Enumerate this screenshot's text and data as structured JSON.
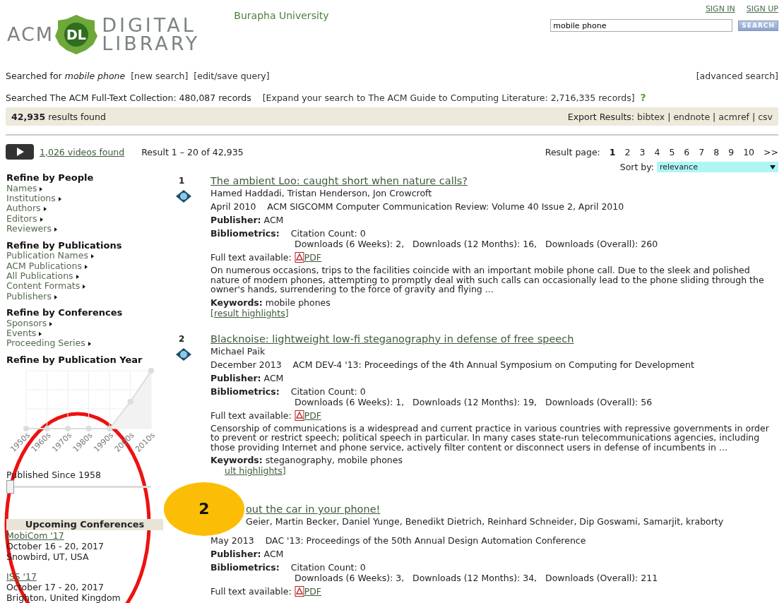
{
  "header": {
    "logo": {
      "left": "ACM",
      "badge": "DL",
      "line1": "DIGITAL",
      "line2": "LIBRARY"
    },
    "institution": "Burapha University",
    "account_links": [
      "SIGN IN",
      "SIGN UP"
    ],
    "search": {
      "value": "mobile phone",
      "button": "SEARCH"
    }
  },
  "query_bar": {
    "prefix": "Searched for",
    "query": "mobile phone",
    "links": [
      "[new search]",
      "[edit/save query]"
    ],
    "advanced": "[advanced search]"
  },
  "collection_line": {
    "text": "Searched The ACM Full-Text Collection: 480,087 records",
    "link": "[Expand your search to The ACM Guide to Computing Literature: 2,716,335 records]",
    "help": "?"
  },
  "results_bar": {
    "count": "42,935",
    "count_label": "results found",
    "export_label": "Export Results:",
    "export_links": [
      "bibtex",
      "endnote",
      "acmref",
      "csv"
    ],
    "separator": "|"
  },
  "videos": {
    "link": "1,026 videos found"
  },
  "range": "Result 1 – 20 of 42,935",
  "pagination": {
    "label": "Result page:",
    "pages": [
      {
        "label": "1",
        "selected": true
      },
      {
        "label": "2",
        "selected": false
      },
      {
        "label": "3",
        "selected": false
      },
      {
        "label": "4",
        "selected": false
      },
      {
        "label": "5",
        "selected": false
      },
      {
        "label": "6",
        "selected": false
      },
      {
        "label": "7",
        "selected": false
      },
      {
        "label": "8",
        "selected": false
      },
      {
        "label": "9",
        "selected": false
      },
      {
        "label": "10",
        "selected": false
      },
      {
        "label": ">>",
        "selected": false
      }
    ]
  },
  "sort": {
    "label": "Sort by:",
    "value": "relevance"
  },
  "sidebar": {
    "sections": [
      {
        "heading": "Refine by People",
        "items": [
          "Names",
          "Institutions",
          "Authors",
          "Editors",
          "Reviewers"
        ]
      },
      {
        "heading": "Refine by Publications",
        "items": [
          "Publication Names",
          "ACM Publications",
          "All Publications",
          "Content Formats",
          "Publishers"
        ]
      },
      {
        "heading": "Refine by Conferences",
        "items": [
          "Sponsors",
          "Events",
          "Proceeding Series"
        ]
      }
    ],
    "year_chart": {
      "heading": "Refine by Publication Year",
      "labels": [
        "1950s",
        "1960s",
        "1970s",
        "1980s",
        "1990s",
        "2000s",
        "2010s"
      ]
    },
    "since": {
      "label": "Published Since 1958",
      "level": 0
    },
    "conferences": {
      "heading": "Upcoming Conferences",
      "items": [
        {
          "name": "MobiCom '17",
          "dates": "October 16 - 20, 2017",
          "place": "Snowbird, UT, USA"
        },
        {
          "name": "ISS '17",
          "dates": "October 17 - 20, 2017",
          "place": "Brighton, United Kingdom"
        }
      ]
    }
  },
  "author_separator": ",",
  "results": [
    {
      "number": "1",
      "title": "The ambient Loo: caught short when nature calls?",
      "authors": [
        "Hamed Haddadi",
        "Tristan Henderson",
        "Jon Crowcroft"
      ],
      "date": "April 2010",
      "venue": "ACM SIGCOMM Computer Communication Review: Volume 40 Issue 2, April 2010",
      "publisher_label": "Publisher:",
      "publisher": "ACM",
      "bibliometrics_label": "Bibliometrics:",
      "citation": "Citation Count: 0",
      "downloads": "Downloads (6 Weeks): 2,   Downloads (12 Months): 16,   Downloads (Overall): 260",
      "fulltext_label": "Full text available:",
      "pdf": "PDF",
      "abstract": "On numerous occasions, trips to the facilities coincide with an important mobile phone call. Due to the sleek and polished nature of modern phones, attempting to promptly deal with such calls can occasionally lead to the phone sliding through the owner's hands, surrendering to the force of gravity and flying ...",
      "keywords_label": "Keywords:",
      "keywords": "mobile phones",
      "highlights": "[result highlights]"
    },
    {
      "number": "2",
      "title": "Blacknoise: lightweight low-fi steganography in defense of free speech",
      "authors": [
        "Michael Paik"
      ],
      "date": "December 2013",
      "venue": "ACM DEV-4 '13: Proceedings of the 4th Annual Symposium on Computing for Development",
      "publisher_label": "Publisher:",
      "publisher": "ACM",
      "bibliometrics_label": "Bibliometrics:",
      "citation": "Citation Count: 0",
      "downloads": "Downloads (6 Weeks): 1,   Downloads (12 Months): 19,   Downloads (Overall): 56",
      "fulltext_label": "Full text available:",
      "pdf": "PDF",
      "abstract": "Censorship of communications is a widespread and current practice in various countries with repressive governments in order to prevent or restrict speech; political speech in particular. In many cases state-run telecommunications agencies, including those providing Internet and phone service, actively filter content or disconnect users in defense of incumbents in ...",
      "keywords_label": "Keywords:",
      "keywords": "steganography, mobile phones",
      "highlights": "ult highlights]"
    },
    {
      "title": "out the car in your phone!",
      "authors": [
        "Geier",
        "Martin Becker",
        "Daniel Yunge",
        "Benedikt Dietrich",
        "Reinhard Schneider",
        "Dip Goswami",
        "Samarjit",
        "kraborty"
      ],
      "date": "May 2013",
      "venue": "DAC '13: Proceedings of the 50th Annual Design Automation Conference",
      "publisher_label": "Publisher:",
      "publisher": "ACM",
      "bibliometrics_label": "Bibliometrics:",
      "citation": "Citation Count: 0",
      "downloads": "Downloads (6 Weeks): 3,   Downloads (12 Months): 34,   Downloads (Overall): 211",
      "fulltext_label": "Full text available:",
      "pdf": "PDF"
    }
  ],
  "annotations": [
    {
      "kind": "ellipse"
    },
    {
      "kind": "badge",
      "label": "2"
    }
  ]
}
